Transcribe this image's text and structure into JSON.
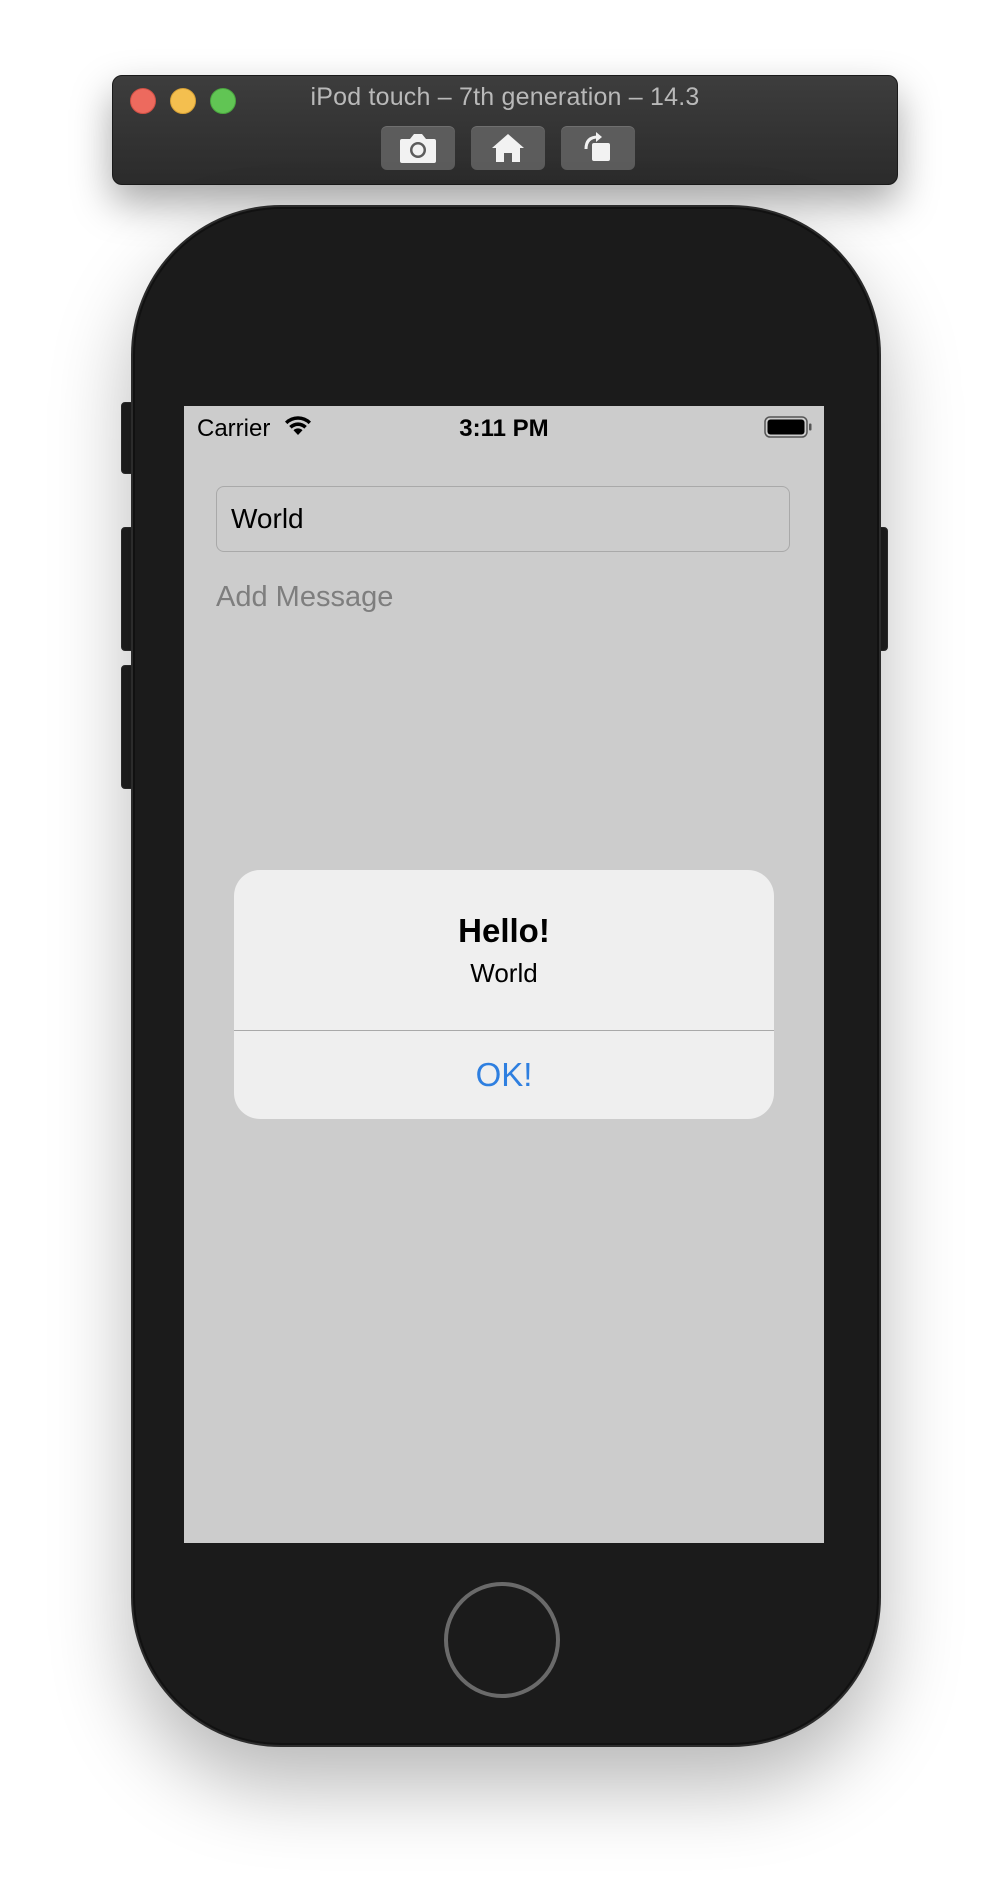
{
  "simulator": {
    "window_title": "iPod touch – 7th generation – 14.3",
    "toolbar": {
      "screenshot_icon": "camera-icon",
      "home_icon": "home-icon",
      "rotate_icon": "rotate-icon"
    }
  },
  "status_bar": {
    "carrier": "Carrier",
    "time": "3:11 PM",
    "wifi_icon": "wifi-icon",
    "battery_icon": "battery-icon"
  },
  "form": {
    "name_value": "World",
    "message_placeholder": "Add Message"
  },
  "alert": {
    "title": "Hello!",
    "message": "World",
    "button_label": "OK!"
  },
  "colors": {
    "screen_background": "#cccccc",
    "alert_background": "#efefef",
    "alert_button": "#2e7fe0",
    "device_body": "#1b1b1b"
  }
}
